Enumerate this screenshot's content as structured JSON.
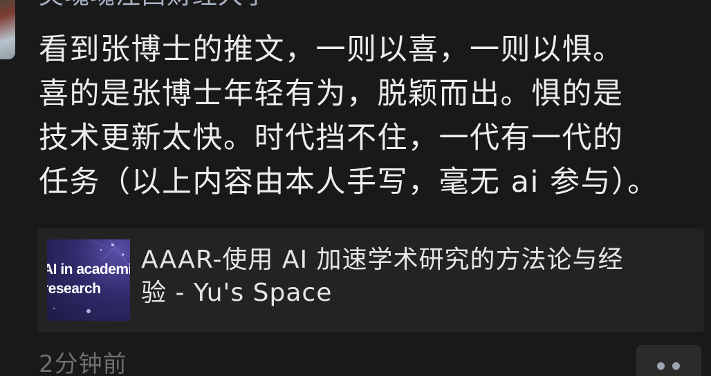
{
  "post": {
    "author_name": "荧魂魂注西财经大学",
    "text_lines": [
      "看到张博士的推文，一则以喜，一则以惧。",
      "喜的是张博士年轻有为，脱颖而出。惧的是",
      "技术更新太快。时代挡不住，一代有一代的",
      "任务（以上内容由本人手写，毫无 ai 参与）。"
    ],
    "timestamp": "2分钟前"
  },
  "link_card": {
    "thumbnail_text_line1": "AI in academic",
    "thumbnail_text_line2": "research",
    "title_lines": [
      "AAAR-使用 AI 加速学术研究的方法论与经",
      "验 - Yu's Space"
    ]
  },
  "icons": {
    "more": "more-dots-icon"
  },
  "colors": {
    "background": "#191919",
    "card_background": "#232323",
    "text": "#ededed",
    "muted_text": "#6f6f6f",
    "author_name": "#a9b3c6"
  }
}
